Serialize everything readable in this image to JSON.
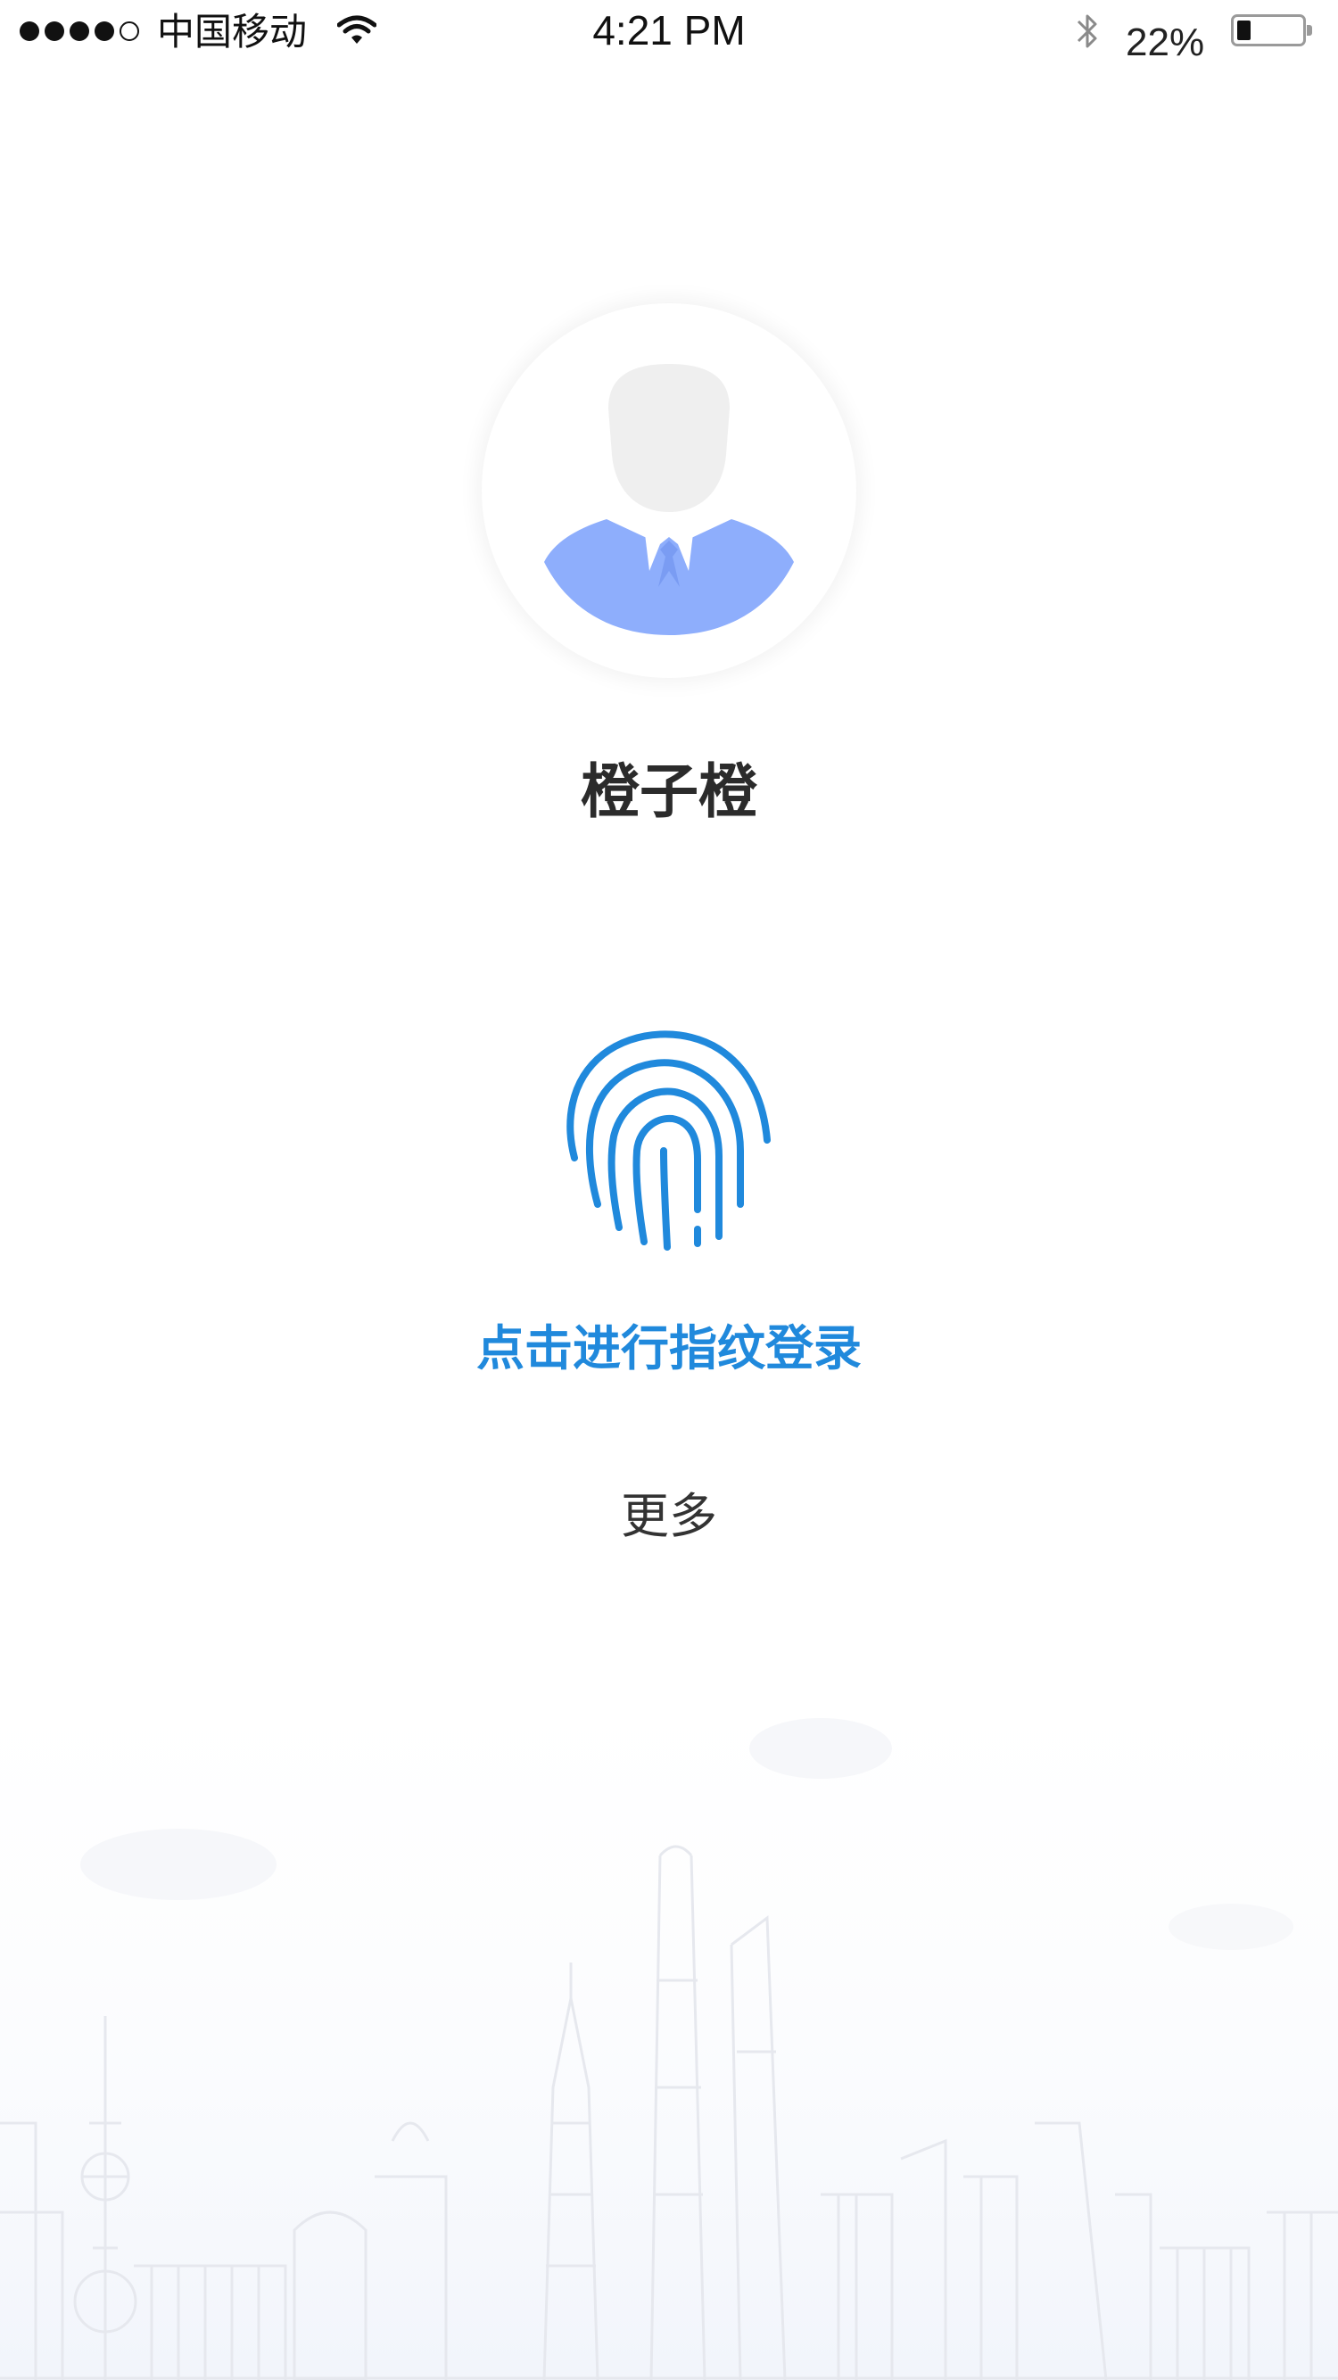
{
  "status_bar": {
    "carrier": "中国移动",
    "time": "4:21 PM",
    "battery_percent": "22%",
    "battery_level": 0.22,
    "signal_bars": 4,
    "signal_max": 5,
    "icons": [
      "signal-dots",
      "wifi-icon",
      "bluetooth-icon",
      "battery-icon"
    ]
  },
  "profile": {
    "avatar_icon": "person-avatar-icon",
    "name": "橙子橙"
  },
  "login": {
    "fingerprint_icon": "fingerprint-icon",
    "fingerprint_label": "点击进行指纹登录",
    "more_label": "更多"
  },
  "colors": {
    "accent": "#2089dc",
    "avatar_body": "#8eaefc",
    "avatar_head": "#efefef",
    "text_dark": "#2b2b2b",
    "background": "#ffffff"
  },
  "background": {
    "decor": "city-skyline-illustration"
  }
}
